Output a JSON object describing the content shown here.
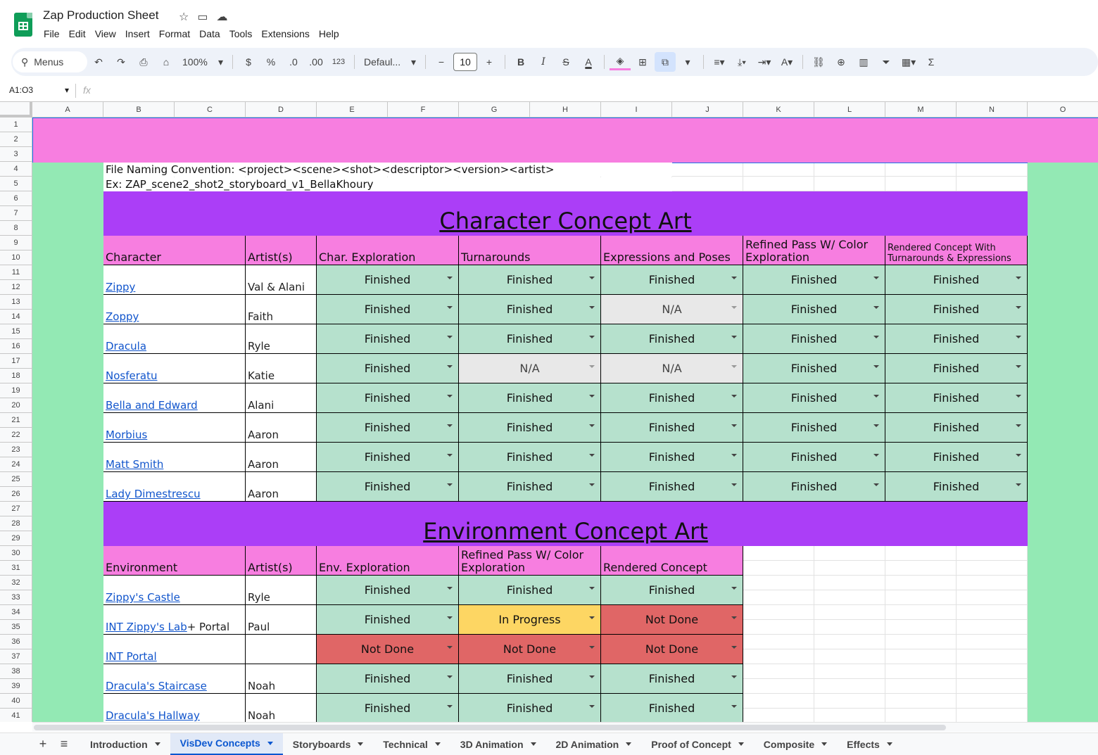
{
  "doc": {
    "title": "Zap Production Sheet"
  },
  "menu": [
    "File",
    "Edit",
    "View",
    "Insert",
    "Format",
    "Data",
    "Tools",
    "Extensions",
    "Help"
  ],
  "toolbar": {
    "search_label": "Menus",
    "zoom": "100%",
    "currency": "$",
    "percent": "%",
    "dec_less": ".0",
    "dec_more": ".00",
    "number_format": "123",
    "font": "Defaul...",
    "font_size": "10"
  },
  "formula": {
    "namebox": "A1:O3",
    "fx": "fx"
  },
  "columns": [
    "A",
    "B",
    "C",
    "D",
    "E",
    "F",
    "G",
    "H",
    "I",
    "J",
    "K",
    "L",
    "M",
    "N",
    "O"
  ],
  "rows": [
    "1",
    "2",
    "3",
    "4",
    "5",
    "6",
    "7",
    "8",
    "9",
    "10",
    "11",
    "12",
    "13",
    "14",
    "15",
    "16",
    "17",
    "18",
    "19",
    "20",
    "21",
    "22",
    "23",
    "24",
    "25",
    "26",
    "27",
    "28",
    "29",
    "30",
    "31",
    "32",
    "33",
    "34",
    "35",
    "36",
    "37",
    "38",
    "39",
    "40",
    "41"
  ],
  "notes": {
    "line1": "File Naming Convention: <project><scene><shot><descriptor><version><artist>",
    "line2": "Ex: ZAP_scene2_shot2_storyboard_v1_BellaKhoury"
  },
  "character_section": {
    "title": "Character Concept Art",
    "headers": [
      "Character",
      "Artist(s)",
      "Char. Exploration",
      "Turnarounds",
      "Expressions and Poses",
      "Refined Pass W/ Color Exploration",
      "Rendered Concept With Turnarounds & Expressions"
    ],
    "rows": [
      {
        "name": "Zippy",
        "artist": "Val & Alani",
        "statuses": [
          "Finished",
          "Finished",
          "Finished",
          "Finished",
          "Finished"
        ]
      },
      {
        "name": "Zoppy",
        "artist": "Faith",
        "statuses": [
          "Finished",
          "Finished",
          "N/A",
          "Finished",
          "Finished"
        ]
      },
      {
        "name": "Dracula",
        "artist": "Ryle",
        "statuses": [
          "Finished",
          "Finished",
          "Finished",
          "Finished",
          "Finished"
        ]
      },
      {
        "name": "Nosferatu",
        "artist": "Katie",
        "statuses": [
          "Finished",
          "N/A",
          "N/A",
          "Finished",
          "Finished"
        ]
      },
      {
        "name": "Bella and Edward",
        "artist": "Alani",
        "statuses": [
          "Finished",
          "Finished",
          "Finished",
          "Finished",
          "Finished"
        ]
      },
      {
        "name": "Morbius",
        "artist": "Aaron",
        "statuses": [
          "Finished",
          "Finished",
          "Finished",
          "Finished",
          "Finished"
        ]
      },
      {
        "name": "Matt Smith",
        "artist": "Aaron",
        "statuses": [
          "Finished",
          "Finished",
          "Finished",
          "Finished",
          "Finished"
        ]
      },
      {
        "name": "Lady Dimestrescu",
        "artist": "Aaron",
        "statuses": [
          "Finished",
          "Finished",
          "Finished",
          "Finished",
          "Finished"
        ]
      }
    ]
  },
  "environment_section": {
    "title": "Environment Concept Art",
    "headers": [
      "Environment",
      "Artist(s)",
      "Env. Exploration",
      "Refined Pass W/ Color Exploration",
      "Rendered Concept"
    ],
    "rows": [
      {
        "name": "Zippy's Castle",
        "suffix": "",
        "artist": "Ryle",
        "statuses": [
          "Finished",
          "Finished",
          "Finished"
        ]
      },
      {
        "name": "INT Zippy's Lab",
        "suffix": "+ Portal",
        "artist": "Paul",
        "statuses": [
          "Finished",
          "In Progress",
          "Not Done"
        ]
      },
      {
        "name": "INT Portal",
        "suffix": "",
        "artist": "",
        "statuses": [
          "Not Done",
          "Not Done",
          "Not Done"
        ]
      },
      {
        "name": "Dracula's Staircase",
        "suffix": "",
        "artist": "Noah",
        "statuses": [
          "Finished",
          "Finished",
          "Finished"
        ]
      },
      {
        "name": "Dracula's Hallway",
        "suffix": "",
        "artist": "Noah",
        "statuses": [
          "Finished",
          "Finished",
          "Finished"
        ]
      }
    ]
  },
  "tabs": [
    {
      "label": "Introduction",
      "active": false
    },
    {
      "label": "VisDev Concepts",
      "active": true
    },
    {
      "label": "Storyboards",
      "active": false
    },
    {
      "label": "Technical",
      "active": false
    },
    {
      "label": "3D Animation",
      "active": false
    },
    {
      "label": "2D Animation",
      "active": false
    },
    {
      "label": "Proof of Concept",
      "active": false
    },
    {
      "label": "Composite",
      "active": false
    },
    {
      "label": "Effects",
      "active": false
    }
  ],
  "colors": {
    "pink": "#f77ee0",
    "purple": "#ab3ef7",
    "green_side": "#93e9b4",
    "finished": "#b6e1cd",
    "na": "#e8e8e8",
    "in_progress": "#fdd663",
    "not_done": "#e06666"
  }
}
